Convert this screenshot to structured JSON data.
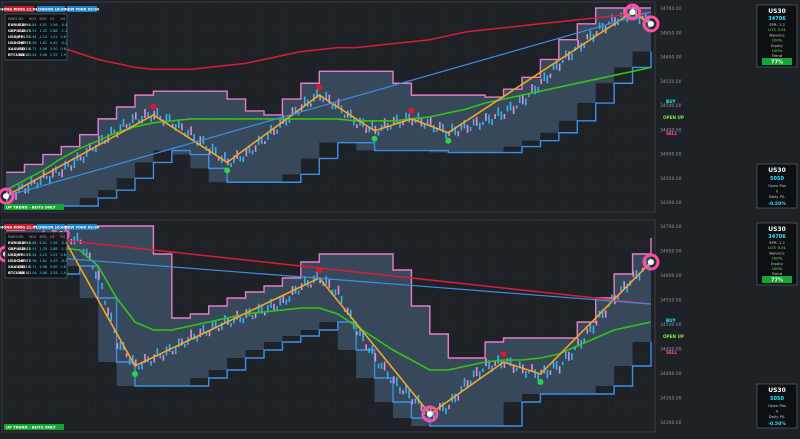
{
  "colors": {
    "background": "#1e2126",
    "grid": "#33373e",
    "band_fill": "#4a6a85",
    "upper_band": "#e57fc6",
    "lower_band": "#3d8fe6",
    "trend_line": "#f5a623",
    "red_curve": "#d81e3a",
    "green_curve": "#34c418",
    "price": "#37b3f0",
    "price_alt": "#e88ad8",
    "marker_green": "#2ed14a",
    "marker_red": "#e0162b",
    "marker_ring": "#ff4fa3",
    "panel_bg": "#0d0f12",
    "table_value": "#ffffff",
    "table_header": "#9aa3ad",
    "up_bar": "#14a532",
    "cyan_value": "#2fe3ff"
  },
  "sessions": {
    "hong_kong": "HONG KONG 21:00",
    "london": "LONDON 16:00",
    "new_york": "NEW YORK 09:00"
  },
  "status_bar": {
    "label": "UP TREND - BUYS ONLY"
  },
  "table": {
    "headers": [
      "PAIRS",
      "M5",
      "M15",
      "M30",
      "H1",
      "H4"
    ],
    "rows": [
      {
        "pair": "EURUSD",
        "values": [
          "1.0894",
          "3.84",
          "4.01",
          "1.56",
          "-0.4"
        ]
      },
      {
        "pair": "GBPUSD",
        "values": [
          "1.2543",
          "3.91",
          "1.35",
          "2.88",
          "-1.1"
        ]
      },
      {
        "pair": "USDJPY",
        "values": [
          "144.92",
          "3.44",
          "2.10",
          "1.01",
          "0.6"
        ]
      },
      {
        "pair": "USDCHF",
        "values": [
          "0.8953",
          "3.58",
          "1.61",
          "0.49",
          "-0.2"
        ]
      },
      {
        "pair": "XAUUSD",
        "values": [
          "1933.8",
          "3.71",
          "4.98",
          "5.00",
          "0.8"
        ]
      },
      {
        "pair": "BTCUSD",
        "values": [
          "26010",
          "3.04",
          "3.06",
          "2.55",
          "1.9"
        ]
      }
    ]
  },
  "signals": {
    "buy": "BUY",
    "open_up": "OPEN UP",
    "sell": "SELL"
  },
  "info_panel_top": {
    "symbol": "US30",
    "price": "34706",
    "lines": [
      "SPR: 1.2",
      "LOT: 0.01",
      "Balance",
      "100%",
      "Equity",
      "100%",
      "Trend"
    ],
    "pct": "77%"
  },
  "info_panel_bottom": {
    "symbol": "US30",
    "price": "5050",
    "lines": [
      "Open Pos",
      "0",
      "Daily P/L"
    ],
    "pct": "-0.50%"
  },
  "axis": {
    "top_price_ticks": [
      "34700.00",
      "34650.00",
      "34600.00",
      "34550.00",
      "34500.00",
      "34450.00",
      "34400.00",
      "34350.00",
      "34300.00"
    ],
    "bottom_price_ticks": [
      "34700.00",
      "34650.00",
      "34600.00",
      "34550.00",
      "34500.00",
      "34450.00",
      "34400.00",
      "34350.00",
      "34300.00"
    ]
  },
  "chart_data": [
    {
      "type": "line",
      "series": [
        {
          "values": [
            0.05,
            0.09,
            0.14,
            0.18,
            0.24,
            0.32,
            0.38,
            0.44,
            0.46,
            0.42,
            0.36,
            0.29,
            0.22,
            0.26,
            0.34,
            0.42,
            0.5,
            0.56,
            0.5,
            0.42,
            0.38,
            0.42,
            0.44,
            0.41,
            0.37,
            0.4,
            0.43,
            0.47,
            0.53,
            0.62,
            0.72,
            0.8,
            0.88,
            0.94,
            0.98,
            0.92
          ]
        },
        {
          "values": [
            0.92,
            0.88,
            0.84,
            0.8,
            0.77,
            0.74,
            0.72,
            0.7,
            0.69,
            0.69,
            0.69,
            0.7,
            0.71,
            0.72,
            0.74,
            0.76,
            0.78,
            0.79,
            0.8,
            0.8,
            0.81,
            0.82,
            0.83,
            0.84,
            0.86,
            0.88,
            0.89,
            0.9,
            0.91,
            0.92,
            0.93,
            0.94,
            0.95,
            0.96,
            0.97,
            0.98
          ]
        },
        {
          "values": [
            0.08,
            0.13,
            0.18,
            0.24,
            0.29,
            0.33,
            0.37,
            0.4,
            0.42,
            0.43,
            0.44,
            0.44,
            0.44,
            0.44,
            0.44,
            0.44,
            0.44,
            0.44,
            0.44,
            0.43,
            0.43,
            0.43,
            0.44,
            0.45,
            0.47,
            0.49,
            0.52,
            0.54,
            0.56,
            0.58,
            0.6,
            0.62,
            0.64,
            0.66,
            0.68,
            0.7
          ]
        }
      ]
    },
    {
      "type": "line",
      "series": [
        {
          "values": [
            0.86,
            0.9,
            0.94,
            0.96,
            0.92,
            0.74,
            0.42,
            0.3,
            0.34,
            0.38,
            0.44,
            0.48,
            0.52,
            0.55,
            0.58,
            0.62,
            0.7,
            0.74,
            0.66,
            0.48,
            0.34,
            0.22,
            0.14,
            0.06,
            0.1,
            0.22,
            0.3,
            0.32,
            0.28,
            0.26,
            0.3,
            0.4,
            0.52,
            0.64,
            0.74,
            0.82
          ]
        },
        {
          "values": [
            0.96,
            0.95,
            0.94,
            0.93,
            0.92,
            0.91,
            0.9,
            0.89,
            0.88,
            0.87,
            0.86,
            0.85,
            0.84,
            0.83,
            0.82,
            0.81,
            0.8,
            0.79,
            0.78,
            0.77,
            0.76,
            0.75,
            0.74,
            0.73,
            0.72,
            0.71,
            0.7,
            0.69,
            0.68,
            0.67,
            0.66,
            0.65,
            0.64,
            0.63,
            0.62,
            0.61
          ]
        },
        {
          "values": [
            0.84,
            0.86,
            0.88,
            0.89,
            0.88,
            0.8,
            0.64,
            0.52,
            0.48,
            0.48,
            0.5,
            0.52,
            0.54,
            0.56,
            0.57,
            0.58,
            0.59,
            0.59,
            0.56,
            0.5,
            0.44,
            0.38,
            0.33,
            0.28,
            0.28,
            0.3,
            0.32,
            0.33,
            0.33,
            0.34,
            0.36,
            0.4,
            0.44,
            0.48,
            0.5,
            0.52
          ]
        }
      ]
    }
  ]
}
